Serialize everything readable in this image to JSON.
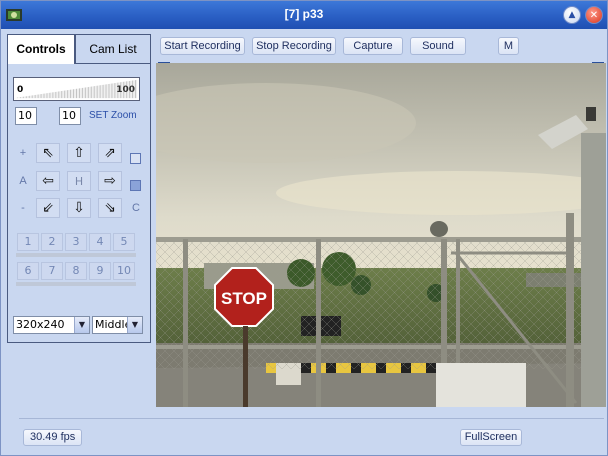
{
  "window": {
    "title": "[7] p33",
    "min_glyph": "▲",
    "close_glyph": "✕",
    "accent": "#2a5fc4"
  },
  "toolbar": {
    "start_recording": "Start Recording",
    "stop_recording": "Stop Recording",
    "capture": "Capture",
    "sound": "Sound",
    "m": "M"
  },
  "tabs": {
    "controls": "Controls",
    "cam_list": "Cam List"
  },
  "zoom": {
    "slider_min": "0",
    "slider_max": "100",
    "value_a": "10",
    "value_b": "10",
    "set_zoom": "SET Zoom"
  },
  "ptz": {
    "side_left": [
      "+",
      "A",
      "-"
    ],
    "side_right_bottom": "C",
    "arrows": {
      "up_left": "⇖",
      "up": "⇧",
      "up_right": "⇗",
      "left": "⇦",
      "home": "H",
      "right": "⇨",
      "down_left": "⇙",
      "down": "⇩",
      "down_right": "⇘"
    }
  },
  "presets": {
    "row1": [
      "1",
      "2",
      "3",
      "4",
      "5"
    ],
    "row2": [
      "6",
      "7",
      "8",
      "9",
      "10"
    ]
  },
  "settings": {
    "resolution": "320x240",
    "position": "Middle",
    "dropdown_glyph": "▼"
  },
  "video": {
    "checkbox_glyph": "✓",
    "stop_sign_text": "STOP"
  },
  "status": {
    "fps": "30.49 fps",
    "fullscreen": "FullScreen"
  }
}
